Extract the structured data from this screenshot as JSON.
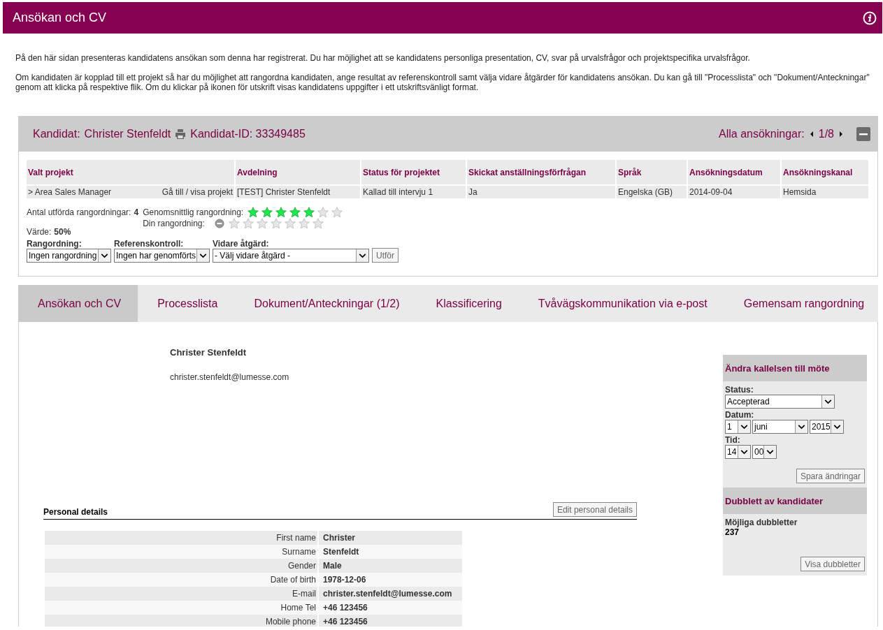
{
  "header": {
    "title": "Ansökan och CV"
  },
  "intro": [
    "På den här sidan presenteras kandidatens ansökan som denna har registrerat. Du har möjlighet att se kandidatens personliga presentation, CV, svar på urvalsfrågor och projektspecifika urvalsfrågor.",
    "Om kandidaten är kopplad till ett projekt så har du möjlighet att rangordna kandidaten, ange resultat av referenskontroll samt välja vidare åtgärder för kandidatens ansökan. Du kan gå till \"Processlista\" och \"Dokument/Anteckningar\" genom att klicka på respektive flik. Om du klickar på ikonen för utskrift visas kandidatens uppgifter i ett utskriftsvänligt format."
  ],
  "candidate": {
    "label": "Kandidat:",
    "name": "Christer Stenfeldt",
    "id_text": "Kandidat-ID: 33349485",
    "applications_label": "Alla ansökningar:",
    "pager": "1/8"
  },
  "project_table": {
    "columns": [
      "Valt projekt",
      "Avdelning",
      "Status för projektet",
      "Skickat anställningsförfrågan",
      "Språk",
      "Ansökningsdatum",
      "Ansökningskanal"
    ],
    "rows": [
      {
        "project_link": "Gå till / visa projekt",
        "cells": [
          "> Area Sales Manager",
          "[TEST] Christer Stenfeldt",
          "Kallad till intervju 1",
          "Ja",
          "Engelska (GB)",
          "2014-09-04",
          "Hemsida"
        ]
      }
    ]
  },
  "ratings": {
    "count_label": "Antal utförda rangordningar:",
    "count": "4",
    "average": {
      "label": "Genomsnittlig rangordning:",
      "stars": 5
    },
    "own": {
      "label": "Din rangordning:",
      "stars": 0
    },
    "value_label": "Värde:",
    "value": "50%"
  },
  "actions": {
    "fields": [
      {
        "label": "Rangordning:",
        "value": "Ingen rangordning"
      },
      {
        "label": "Referenskontroll:",
        "value": "Ingen har genomförts"
      },
      {
        "label": "Vidare åtgärd:",
        "value": "- Välj vidare åtgärd -"
      }
    ],
    "button": "Utför"
  },
  "tabs": [
    {
      "label": "Ansökan och CV",
      "selected": true
    },
    {
      "label": "Processlista",
      "selected": false
    },
    {
      "label": "Dokument/Anteckningar (1/2)",
      "selected": false
    },
    {
      "label": "Klassificering",
      "selected": false
    },
    {
      "label": "Tvåvägskommunikation via e-post",
      "selected": false
    },
    {
      "label": "Gemensam rangordning",
      "selected": false
    }
  ],
  "profile": {
    "name": "Christer Stenfeldt",
    "email": "christer.stenfeldt@lumesse.com",
    "section_title": "Personal details",
    "edit_button": "Edit personal details",
    "fields": [
      {
        "label": "First name",
        "value": "Christer"
      },
      {
        "label": "Surname",
        "value": "Stenfeldt"
      },
      {
        "label": "Gender",
        "value": "Male"
      },
      {
        "label": "Date of birth",
        "value": "1978-12-06"
      },
      {
        "label": "E-mail",
        "value": "christer.stenfeldt@lumesse.com"
      },
      {
        "label": "Home Tel",
        "value": "+46 123456"
      },
      {
        "label": "Mobile phone",
        "value": "+46 123456"
      }
    ]
  },
  "meeting": {
    "title": "Ändra kallelsen till möte",
    "status_label": "Status:",
    "status": "Accepterad",
    "date_label": "Datum:",
    "day": "1",
    "month": "juni",
    "year": "2015",
    "time_label": "Tid:",
    "hour": "14",
    "minute": "00",
    "save_button": "Spara ändringar"
  },
  "duplicates": {
    "title": "Dubblett av kandidater",
    "label": "Möjliga dubbletter",
    "count": "237",
    "button": "Visa dubbletter"
  }
}
